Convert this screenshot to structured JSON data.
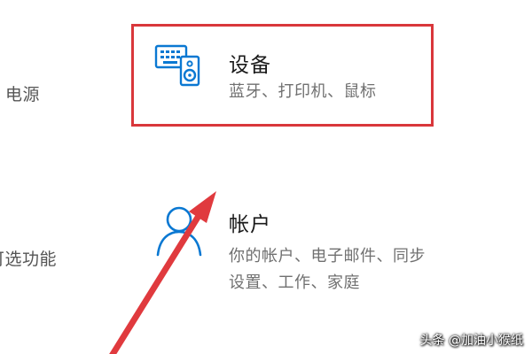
{
  "left_column": {
    "power": "电源",
    "optional_features": "可选功能"
  },
  "devices_tile": {
    "icon": "keyboard-speaker-icon",
    "title": "设备",
    "description": "蓝牙、打印机、鼠标"
  },
  "accounts_tile": {
    "icon": "person-icon",
    "title": "帐户",
    "description_line1": "你的帐户、电子邮件、同步",
    "description_line2": "设置、工作、家庭"
  },
  "annotations": {
    "highlight_color": "#d9373b",
    "arrow_color": "#e03a3e"
  },
  "watermark": {
    "text": "头条 @加油小猴纸"
  },
  "colors": {
    "accent": "#0a78d2",
    "title_text": "#1a1a1a",
    "description_text": "#707070"
  }
}
